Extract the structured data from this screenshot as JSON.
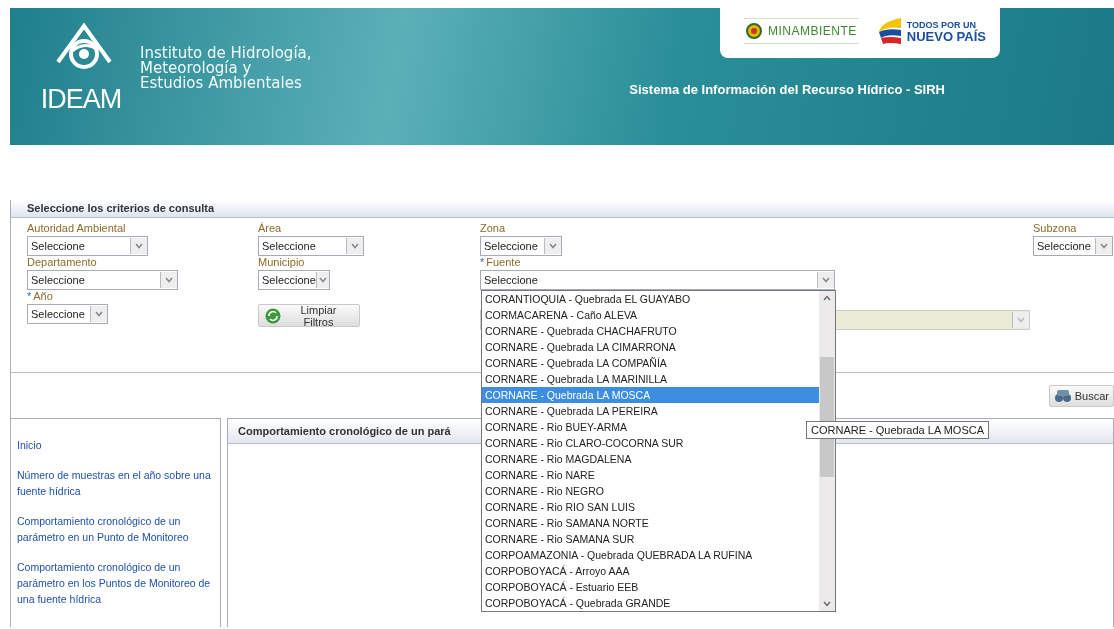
{
  "header": {
    "logo_text": "IDEAM",
    "institute_name": [
      "Instituto de Hidrología,",
      "Meteorología y",
      "Estudios Ambientales"
    ],
    "ministry": "MINAMBIENTE",
    "slogan": [
      "TODOS POR UN",
      "NUEVO PAÍS"
    ],
    "system_title": "Sistema de Información del Recurso Hídrico - SIRH"
  },
  "filters": {
    "title": "Seleccione los criterios de consulta",
    "fields": [
      {
        "label": "Autoridad Ambiental",
        "value": "Seleccione"
      },
      {
        "label": "Área",
        "value": "Seleccione"
      },
      {
        "label": "Zona",
        "value": "Seleccione"
      },
      {
        "label": "Subzona",
        "value": "Seleccione"
      },
      {
        "label": "Departamento",
        "value": "Seleccione"
      },
      {
        "label": "Municipio",
        "value": "Seleccione"
      },
      {
        "label": "Fuente",
        "required_mark": "*",
        "value": "Seleccione",
        "expanded": true
      },
      {
        "label": "Año",
        "required_mark": "*",
        "value": "Seleccione"
      }
    ],
    "clear_button": "Limpiar Filtros",
    "covered_select": {
      "disabled": true
    },
    "search_button": "Buscar"
  },
  "fuente_options": [
    {
      "label": "CORANTIOQUIA - Quebrada EL GUAYABO",
      "selected": false
    },
    {
      "label": "CORMACARENA - Caño ALEVA",
      "selected": false
    },
    {
      "label": "CORNARE - Quebrada CHACHAFRUTO",
      "selected": false
    },
    {
      "label": "CORNARE - Quebrada LA CIMARRONA",
      "selected": false
    },
    {
      "label": "CORNARE - Quebrada LA COMPAÑÍA",
      "selected": false
    },
    {
      "label": "CORNARE - Quebrada LA MARINILLA",
      "selected": false
    },
    {
      "label": "CORNARE - Quebrada LA MOSCA",
      "selected": true
    },
    {
      "label": "CORNARE - Quebrada LA PEREIRA",
      "selected": false
    },
    {
      "label": "CORNARE - Rio BUEY-ARMA",
      "selected": false
    },
    {
      "label": "CORNARE - Rio CLARO-COCORNA SUR",
      "selected": false
    },
    {
      "label": "CORNARE - Rio MAGDALENA",
      "selected": false
    },
    {
      "label": "CORNARE - Rio NARE",
      "selected": false
    },
    {
      "label": "CORNARE - Rio NEGRO",
      "selected": false
    },
    {
      "label": "CORNARE - Rio RIO SAN LUIS",
      "selected": false
    },
    {
      "label": "CORNARE - Rio SAMANA NORTE",
      "selected": false
    },
    {
      "label": "CORNARE - Rio SAMANA SUR",
      "selected": false
    },
    {
      "label": "CORPOAMAZONIA - Quebrada QUEBRADA LA RUFINA",
      "selected": false
    },
    {
      "label": "CORPOBOYACÁ - Arroyo AAA",
      "selected": false
    },
    {
      "label": "CORPOBOYACÁ - Estuario EEB",
      "selected": false
    },
    {
      "label": "CORPOBOYACÁ - Quebrada GRANDE",
      "selected": false
    }
  ],
  "tooltip": "CORNARE - Quebrada LA MOSCA",
  "sidebar": {
    "items": [
      {
        "label": "Inicio"
      },
      {
        "label": "Número de muestras en el año sobre una fuente hídrica"
      },
      {
        "label": "Comportamiento cronológico de un parámetro en un Punto de Monitoreo"
      },
      {
        "label": "Comportamiento cronológico de un parámetro en los Puntos de Monitoreo de una fuente hídrica"
      }
    ]
  },
  "content": {
    "title": "Comportamiento cronológico de un pará"
  }
}
